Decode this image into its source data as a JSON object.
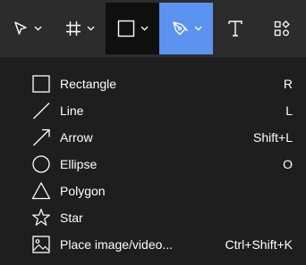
{
  "toolbar": {
    "tools": [
      {
        "name": "move",
        "icon": "cursor-icon",
        "has_dropdown": true
      },
      {
        "name": "frame",
        "icon": "frame-icon",
        "has_dropdown": true
      },
      {
        "name": "shape",
        "icon": "square-icon",
        "has_dropdown": true,
        "state": "menu-open"
      },
      {
        "name": "pen",
        "icon": "pen-icon",
        "has_dropdown": true,
        "state": "active"
      },
      {
        "name": "text",
        "icon": "text-icon",
        "has_dropdown": false
      },
      {
        "name": "resources",
        "icon": "resources-icon",
        "has_dropdown": false
      }
    ],
    "active_color": "#5c93f0"
  },
  "menu": {
    "items": [
      {
        "label": "Rectangle",
        "shortcut": "R",
        "icon": "rectangle-icon"
      },
      {
        "label": "Line",
        "shortcut": "L",
        "icon": "line-icon"
      },
      {
        "label": "Arrow",
        "shortcut": "Shift+L",
        "icon": "arrow-icon"
      },
      {
        "label": "Ellipse",
        "shortcut": "O",
        "icon": "ellipse-icon"
      },
      {
        "label": "Polygon",
        "shortcut": "",
        "icon": "polygon-icon"
      },
      {
        "label": "Star",
        "shortcut": "",
        "icon": "star-icon"
      },
      {
        "label": "Place image/video...",
        "shortcut": "Ctrl+Shift+K",
        "icon": "image-icon"
      }
    ]
  }
}
